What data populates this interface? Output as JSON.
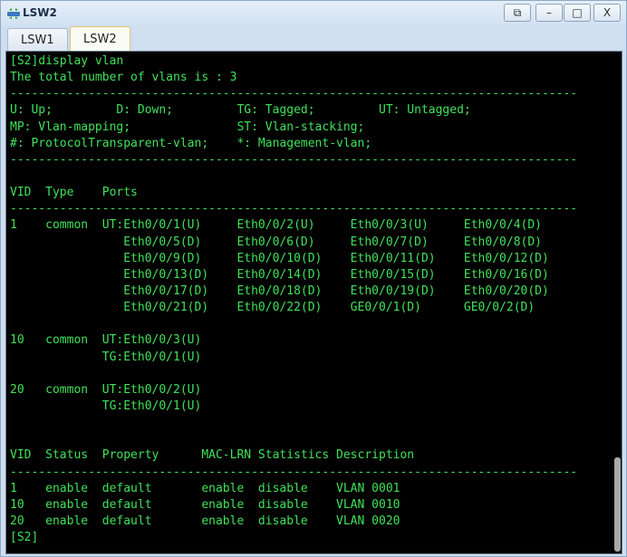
{
  "window": {
    "title": "LSW2",
    "controls": {
      "restore": "⧉",
      "minimize": "–",
      "maximize": "□",
      "close": "X"
    }
  },
  "tabs": [
    {
      "label": "LSW1",
      "active": false
    },
    {
      "label": "LSW2",
      "active": true
    }
  ],
  "terminal": {
    "text_color": "#41e15a",
    "background": "#000000",
    "lines": [
      "[S2]display vlan",
      "The total number of vlans is : 3",
      "--------------------------------------------------------------------------------",
      "U: Up;         D: Down;         TG: Tagged;         UT: Untagged;",
      "MP: Vlan-mapping;               ST: Vlan-stacking;",
      "#: ProtocolTransparent-vlan;    *: Management-vlan;",
      "--------------------------------------------------------------------------------",
      "",
      "VID  Type    Ports",
      "--------------------------------------------------------------------------------",
      "1    common  UT:Eth0/0/1(U)     Eth0/0/2(U)     Eth0/0/3(U)     Eth0/0/4(D)",
      "                Eth0/0/5(D)     Eth0/0/6(D)     Eth0/0/7(D)     Eth0/0/8(D)",
      "                Eth0/0/9(D)     Eth0/0/10(D)    Eth0/0/11(D)    Eth0/0/12(D)",
      "                Eth0/0/13(D)    Eth0/0/14(D)    Eth0/0/15(D)    Eth0/0/16(D)",
      "                Eth0/0/17(D)    Eth0/0/18(D)    Eth0/0/19(D)    Eth0/0/20(D)",
      "                Eth0/0/21(D)    Eth0/0/22(D)    GE0/0/1(D)      GE0/0/2(D)",
      "",
      "10   common  UT:Eth0/0/3(U)",
      "             TG:Eth0/0/1(U)",
      "",
      "20   common  UT:Eth0/0/2(U)",
      "             TG:Eth0/0/1(U)",
      "",
      "",
      "VID  Status  Property      MAC-LRN Statistics Description",
      "--------------------------------------------------------------------------------",
      "1    enable  default       enable  disable    VLAN 0001",
      "10   enable  default       enable  disable    VLAN 0010",
      "20   enable  default       enable  disable    VLAN 0020",
      "[S2]"
    ]
  }
}
